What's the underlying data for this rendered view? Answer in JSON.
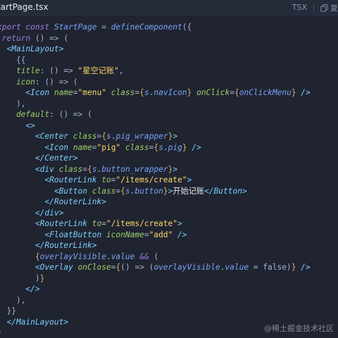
{
  "header": {
    "filename": "tartPage.tsx",
    "language": "TSX",
    "copy_label": "复",
    "copy_icon": "copy-icon"
  },
  "watermark": "@稀土掘金技术社区",
  "colors": {
    "background": "#1f2430",
    "keyword": "#9d7cd8",
    "tag": "#7dcfff",
    "attribute": "#9ece6a",
    "string": "#ffd866",
    "variable": "#7aa2f7",
    "punctuation": "#e0af68"
  },
  "code": {
    "lines": [
      [
        [
          "keyword",
          "xport const "
        ],
        [
          "var",
          "StartPage"
        ],
        [
          "default",
          " = "
        ],
        [
          "var",
          "defineComponent"
        ],
        [
          "default",
          "({"
        ]
      ],
      [
        [
          "default",
          " "
        ],
        [
          "keyword",
          "return"
        ],
        [
          "default",
          " () => ("
        ]
      ],
      [
        [
          "default",
          "  "
        ],
        [
          "tag",
          "<MainLayout>"
        ]
      ],
      [
        [
          "default",
          "    {{"
        ]
      ],
      [
        [
          "default",
          "    "
        ],
        [
          "attr",
          "title"
        ],
        [
          "default",
          ": () => "
        ],
        [
          "string",
          "\"星空记账\""
        ],
        [
          "default",
          ","
        ]
      ],
      [
        [
          "default",
          "    "
        ],
        [
          "attr",
          "icon"
        ],
        [
          "default",
          ": () => ("
        ]
      ],
      [
        [
          "default",
          "      "
        ],
        [
          "tag",
          "<Icon "
        ],
        [
          "attr",
          "name"
        ],
        [
          "default",
          "="
        ],
        [
          "string",
          "\"menu\""
        ],
        [
          "default",
          " "
        ],
        [
          "attr",
          "class"
        ],
        [
          "default",
          "="
        ],
        [
          "punct",
          "{"
        ],
        [
          "var",
          "s"
        ],
        [
          "default",
          "."
        ],
        [
          "var",
          "navIcon"
        ],
        [
          "punct",
          "}"
        ],
        [
          "default",
          " "
        ],
        [
          "attr",
          "onClick"
        ],
        [
          "default",
          "="
        ],
        [
          "punct",
          "{"
        ],
        [
          "var",
          "onClickMenu"
        ],
        [
          "punct",
          "}"
        ],
        [
          "tag",
          " />"
        ]
      ],
      [
        [
          "default",
          "    ),"
        ]
      ],
      [
        [
          "default",
          "    "
        ],
        [
          "attr",
          "default"
        ],
        [
          "default",
          ": () => ("
        ]
      ],
      [
        [
          "default",
          "      "
        ],
        [
          "tag",
          "<>"
        ]
      ],
      [
        [
          "default",
          "        "
        ],
        [
          "tag",
          "<Center "
        ],
        [
          "attr",
          "class"
        ],
        [
          "default",
          "="
        ],
        [
          "punct",
          "{"
        ],
        [
          "var",
          "s"
        ],
        [
          "default",
          "."
        ],
        [
          "var",
          "pig_wrapper"
        ],
        [
          "punct",
          "}"
        ],
        [
          "tag",
          ">"
        ]
      ],
      [
        [
          "default",
          "          "
        ],
        [
          "tag",
          "<Icon "
        ],
        [
          "attr",
          "name"
        ],
        [
          "default",
          "="
        ],
        [
          "string",
          "\"pig\""
        ],
        [
          "default",
          " "
        ],
        [
          "attr",
          "class"
        ],
        [
          "default",
          "="
        ],
        [
          "punct",
          "{"
        ],
        [
          "var",
          "s"
        ],
        [
          "default",
          "."
        ],
        [
          "var",
          "pig"
        ],
        [
          "punct",
          "}"
        ],
        [
          "tag",
          " />"
        ]
      ],
      [
        [
          "default",
          "        "
        ],
        [
          "tag",
          "</Center>"
        ]
      ],
      [
        [
          "default",
          "        "
        ],
        [
          "tag",
          "<div "
        ],
        [
          "attr",
          "class"
        ],
        [
          "default",
          "="
        ],
        [
          "punct",
          "{"
        ],
        [
          "var",
          "s"
        ],
        [
          "default",
          "."
        ],
        [
          "var",
          "button_wrapper"
        ],
        [
          "punct",
          "}"
        ],
        [
          "tag",
          ">"
        ]
      ],
      [
        [
          "default",
          "          "
        ],
        [
          "tag",
          "<RouterLink "
        ],
        [
          "attr",
          "to"
        ],
        [
          "default",
          "="
        ],
        [
          "string",
          "\"/items/create\""
        ],
        [
          "tag",
          ">"
        ]
      ],
      [
        [
          "default",
          "            "
        ],
        [
          "tag",
          "<Button "
        ],
        [
          "attr",
          "class"
        ],
        [
          "default",
          "="
        ],
        [
          "punct",
          "{"
        ],
        [
          "var",
          "s"
        ],
        [
          "default",
          "."
        ],
        [
          "var",
          "button"
        ],
        [
          "punct",
          "}"
        ],
        [
          "tag",
          ">"
        ],
        [
          "text",
          "开始记账"
        ],
        [
          "tag",
          "</Button>"
        ]
      ],
      [
        [
          "default",
          "          "
        ],
        [
          "tag",
          "</RouterLink>"
        ]
      ],
      [
        [
          "default",
          "        "
        ],
        [
          "tag",
          "</div>"
        ]
      ],
      [
        [
          "default",
          "        "
        ],
        [
          "tag",
          "<RouterLink "
        ],
        [
          "attr",
          "to"
        ],
        [
          "default",
          "="
        ],
        [
          "string",
          "\"/items/create\""
        ],
        [
          "tag",
          ">"
        ]
      ],
      [
        [
          "default",
          "          "
        ],
        [
          "tag",
          "<FloatButton "
        ],
        [
          "attr",
          "iconName"
        ],
        [
          "default",
          "="
        ],
        [
          "string",
          "\"add\""
        ],
        [
          "tag",
          " />"
        ]
      ],
      [
        [
          "default",
          "        "
        ],
        [
          "tag",
          "</RouterLink>"
        ]
      ],
      [
        [
          "default",
          "        "
        ],
        [
          "punct",
          "{"
        ],
        [
          "var",
          "overlayVisible"
        ],
        [
          "default",
          "."
        ],
        [
          "var",
          "value"
        ],
        [
          "default",
          " "
        ],
        [
          "keyword",
          "&&"
        ],
        [
          "default",
          " ("
        ]
      ],
      [
        [
          "default",
          "        "
        ],
        [
          "tag",
          "<Overlay "
        ],
        [
          "attr",
          "onClose"
        ],
        [
          "default",
          "="
        ],
        [
          "punct",
          "{"
        ],
        [
          "default",
          "() => ("
        ],
        [
          "var",
          "overlayVisible"
        ],
        [
          "default",
          "."
        ],
        [
          "var",
          "value"
        ],
        [
          "default",
          " = false)"
        ],
        [
          "punct",
          "}"
        ],
        [
          "tag",
          " />"
        ]
      ],
      [
        [
          "default",
          "        )"
        ],
        [
          "punct",
          "}"
        ]
      ],
      [
        [
          "default",
          "      "
        ],
        [
          "tag",
          "</>"
        ]
      ],
      [
        [
          "default",
          "    ),"
        ]
      ],
      [
        [
          "default",
          "  }}"
        ]
      ],
      [
        [
          "default",
          "  "
        ],
        [
          "tag",
          "</MainLayout>"
        ]
      ],
      [
        [
          "default",
          ")"
        ]
      ]
    ]
  }
}
